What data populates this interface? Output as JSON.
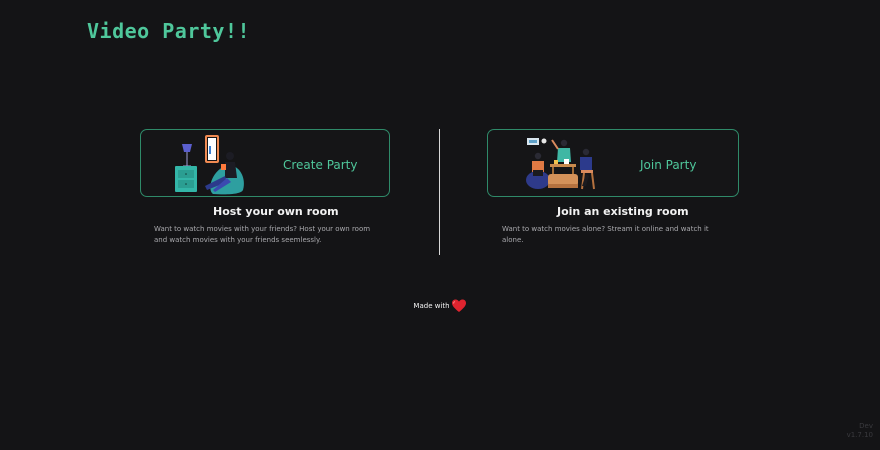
{
  "header": {
    "title": "Video Party!!"
  },
  "create": {
    "button_label": "Create Party",
    "heading": "Host your own room",
    "description": "Want to watch movies with your friends? Host your own room and watch movies with your friends seemlessly."
  },
  "join": {
    "button_label": "Join Party",
    "heading": "Join an existing room",
    "description": "Want to watch movies alone? Stream it online and watch it alone."
  },
  "footer": {
    "made_with": "Made with"
  },
  "version": {
    "line1": "Dev",
    "line2": "v1.7.10"
  },
  "colors": {
    "accent": "#4fc79b",
    "background": "#141416",
    "card_border": "#2f8a69",
    "heart": "#e0242f"
  },
  "icons": {
    "heart": "heart-icon",
    "create_illustration": "person-watching-phone-illustration",
    "join_illustration": "friends-group-illustration"
  }
}
